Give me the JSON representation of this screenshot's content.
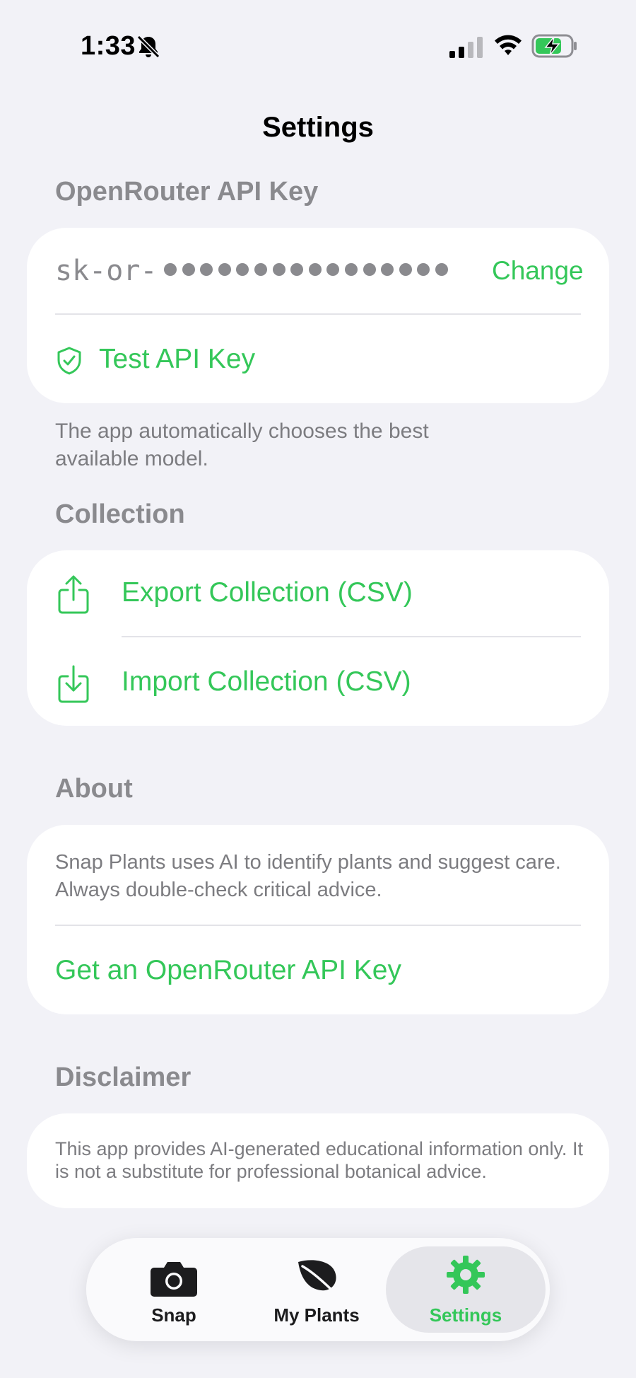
{
  "status_bar": {
    "time": "1:33",
    "icons": [
      "bell-slash-icon",
      "cellular-signal-icon",
      "wifi-icon",
      "battery-charging-icon"
    ]
  },
  "nav": {
    "title": "Settings"
  },
  "colors": {
    "accent": "#34C759",
    "background": "#F2F2F7",
    "secondary_text": "#8A8A8E"
  },
  "api_key_section": {
    "header": "OpenRouter API Key",
    "masked_key_prefix": "sk-or-",
    "masked_key_dot_count": 16,
    "change_label": "Change",
    "test_label": "Test API Key",
    "test_icon": "checkmark-shield-icon",
    "footnote": "The app automatically chooses the best available model."
  },
  "collection_section": {
    "header": "Collection",
    "export_label": "Export Collection (CSV)",
    "export_icon": "share-upload-icon",
    "import_label": "Import Collection (CSV)",
    "import_icon": "download-tray-icon"
  },
  "about_section": {
    "header": "About",
    "description": "Snap Plants uses AI to identify plants and suggest care. Always double-check critical advice.",
    "link_label": "Get an OpenRouter API Key"
  },
  "disclaimer_section": {
    "header": "Disclaimer",
    "text": "This app provides AI-generated educational information only. It is not a substitute for professional botanical advice."
  },
  "tab_bar": {
    "tabs": [
      {
        "label": "Snap",
        "icon": "camera-icon",
        "active": false
      },
      {
        "label": "My Plants",
        "icon": "leaf-icon",
        "active": false
      },
      {
        "label": "Settings",
        "icon": "gear-icon",
        "active": true
      }
    ]
  }
}
